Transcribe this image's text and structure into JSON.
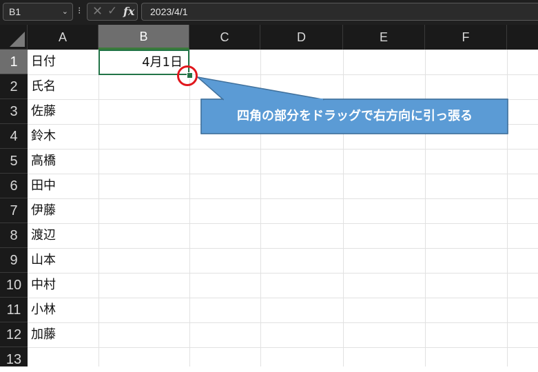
{
  "formula_bar": {
    "name_box": "B1",
    "name_box_arrow": "⌄",
    "separator": "⁝",
    "cancel_icon": "✕",
    "enter_icon": "✓",
    "function_label": "fx",
    "value": "2023/4/1"
  },
  "columns": [
    "A",
    "B",
    "C",
    "D",
    "E",
    "F"
  ],
  "rows": [
    "1",
    "2",
    "3",
    "4",
    "5",
    "6",
    "7",
    "8",
    "9",
    "10",
    "11",
    "12",
    "13"
  ],
  "column_a": [
    "日付",
    "氏名",
    "佐藤",
    "鈴木",
    "高橋",
    "田中",
    "伊藤",
    "渡辺",
    "山本",
    "中村",
    "小林",
    "加藤"
  ],
  "selected_cell": {
    "address": "B1",
    "value": "4月1日"
  },
  "callout": {
    "text": "四角の部分をドラッグで右方向に引っ張る",
    "fill": "#5b9bd5",
    "border": "#41719c",
    "circle_color": "#e0161c"
  },
  "colors": {
    "selection": "#217346",
    "header_bg": "#1a1a1a",
    "selected_header_bg": "#6e6e6e"
  }
}
